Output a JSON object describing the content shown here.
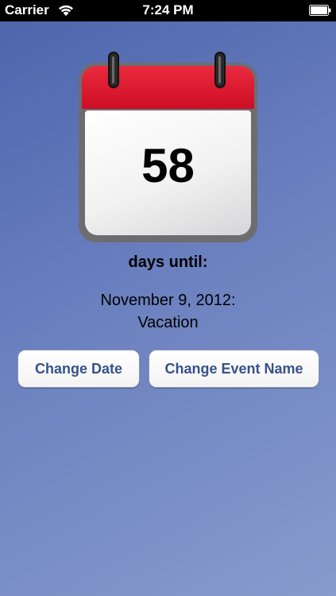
{
  "status_bar": {
    "carrier": "Carrier",
    "time": "7:24 PM",
    "wifi_icon": "wifi-icon",
    "battery_icon": "battery-full-icon"
  },
  "calendar": {
    "days": "58",
    "header_color": "#dc1a30",
    "icon": "calendar-icon"
  },
  "labels": {
    "days_until": "days until:",
    "event_date": "November 9, 2012:",
    "event_name": "Vacation"
  },
  "buttons": {
    "change_date": "Change Date",
    "change_event_name": "Change Event Name"
  },
  "colors": {
    "background_top": "#4d66ac",
    "background_bottom": "#879bcc",
    "button_text": "#36518a"
  }
}
